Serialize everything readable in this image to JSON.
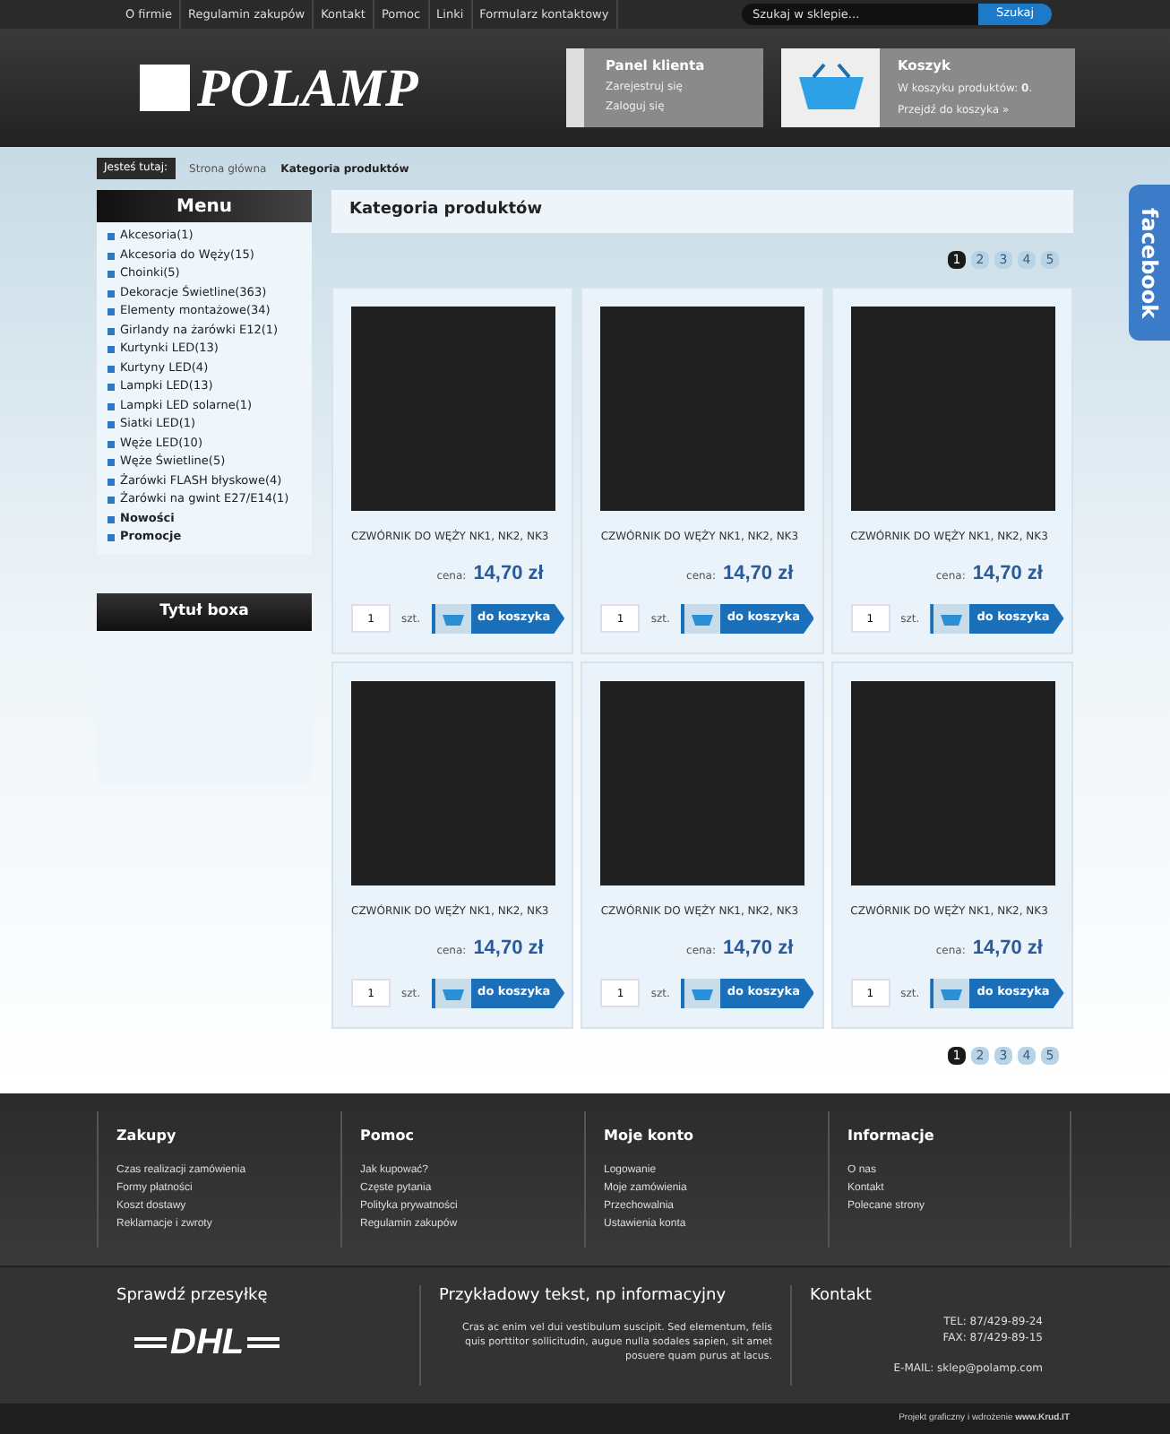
{
  "top_nav": {
    "links": [
      "O firmie",
      "Regulamin zakupów",
      "Kontakt",
      "Pomoc",
      "Linki",
      "Formularz kontaktowy"
    ],
    "search": {
      "placeholder": "Szukaj w sklepie..."
    },
    "search_button": "Szukaj"
  },
  "logo": "POLAMP",
  "client_panel": {
    "title": "Panel klienta",
    "links": [
      "Zarejestruj się",
      "Zaloguj się"
    ]
  },
  "cart": {
    "title": "Koszyk",
    "summary": "W koszyku produktów: **0**.",
    "link": "Przejdź do koszyka »"
  },
  "breadcrumb": {
    "label": "Jesteś tutaj:",
    "items": [
      "Strona główna",
      "Kategoria produktów"
    ]
  },
  "menu": {
    "title": "Menu",
    "items": [
      {
        "label": "Akcesoria(1)",
        "bold": false
      },
      {
        "label": "Akcesoria do Węży(15)",
        "bold": false
      },
      {
        "label": "Choinki(5)",
        "bold": false
      },
      {
        "label": "Dekoracje Świetline(363)",
        "bold": false
      },
      {
        "label": "Elementy montażowe(34)",
        "bold": false
      },
      {
        "label": "Girlandy na żarówki E12(1)",
        "bold": false
      },
      {
        "label": "Kurtynki LED(13)",
        "bold": false
      },
      {
        "label": "Kurtyny LED(4)",
        "bold": false
      },
      {
        "label": "Lampki LED(13)",
        "bold": false
      },
      {
        "label": "Lampki LED solarne(1)",
        "bold": false
      },
      {
        "label": "Siatki LED(1)",
        "bold": false
      },
      {
        "label": "Węże LED(10)",
        "bold": false
      },
      {
        "label": "Węże Świetline(5)",
        "bold": false
      },
      {
        "label": "Żarówki FLASH błyskowe(4)",
        "bold": false
      },
      {
        "label": "Żarówki na gwint E27/E14(1)",
        "bold": false
      },
      {
        "label": "Nowości",
        "bold": true
      },
      {
        "label": "Promocje",
        "bold": true
      }
    ]
  },
  "side_box": {
    "title": "Tytuł boxa"
  },
  "content": {
    "title": "Kategoria produktów",
    "pagination_top": [
      {
        "label": "1",
        "selected": true
      },
      {
        "label": "2",
        "selected": false
      },
      {
        "label": "3",
        "selected": false
      },
      {
        "label": "4",
        "selected": false
      },
      {
        "label": "5",
        "selected": false
      }
    ],
    "products": [
      {
        "name": "CZWÓRNIK DO WĘŻY NK1, NK2, NK3",
        "price_label": "cena:",
        "price": "14,70 zł",
        "qty": "1",
        "unit": "szt.",
        "button": "do koszyka"
      },
      {
        "name": "CZWÓRNIK DO WĘŻY NK1, NK2, NK3",
        "price_label": "cena:",
        "price": "14,70 zł",
        "qty": "1",
        "unit": "szt.",
        "button": "do koszyka"
      },
      {
        "name": "CZWÓRNIK DO WĘŻY NK1, NK2, NK3",
        "price_label": "cena:",
        "price": "14,70 zł",
        "qty": "1",
        "unit": "szt.",
        "button": "do koszyka"
      },
      {
        "name": "CZWÓRNIK DO WĘŻY NK1, NK2, NK3",
        "price_label": "cena:",
        "price": "14,70 zł",
        "qty": "1",
        "unit": "szt.",
        "button": "do koszyka"
      },
      {
        "name": "CZWÓRNIK DO WĘŻY NK1, NK2, NK3",
        "price_label": "cena:",
        "price": "14,70 zł",
        "qty": "1",
        "unit": "szt.",
        "button": "do koszyka"
      },
      {
        "name": "CZWÓRNIK DO WĘŻY NK1, NK2, NK3",
        "price_label": "cena:",
        "price": "14,70 zł",
        "qty": "1",
        "unit": "szt.",
        "button": "do koszyka"
      }
    ],
    "pagination_bottom": [
      {
        "label": "1",
        "selected": true
      },
      {
        "label": "2",
        "selected": false
      },
      {
        "label": "3",
        "selected": false
      },
      {
        "label": "4",
        "selected": false
      },
      {
        "label": "5",
        "selected": false
      }
    ]
  },
  "facebook_tab": "facebook",
  "footer_columns": [
    {
      "title": "Zakupy",
      "links": [
        "Czas realizacji zamówienia",
        "Formy płatności",
        "Koszt dostawy",
        "Reklamacje i zwroty"
      ]
    },
    {
      "title": "Pomoc",
      "links": [
        "Jak kupować?",
        "Częste pytania",
        "Polityka prywatności",
        "Regulamin zakupów"
      ]
    },
    {
      "title": "Moje konto",
      "links": [
        "Logowanie",
        "Moje zamówienia",
        "Przechowalnia",
        "Ustawienia konta"
      ]
    },
    {
      "title": "Informacje",
      "links": [
        "O nas",
        "Kontakt",
        "Polecane strony"
      ]
    }
  ],
  "footer_info": {
    "tracking_title": "Sprawdź przesyłkę",
    "courier_logo": "DHL",
    "text_title": "Przykładowy tekst, np informacyjny",
    "text": "Cras ac enim vel dui vestibulum suscipit. Sed elementum, felis quis porttitor sollicitudin, augue nulla sodales sapien, sit amet posuere quam purus at lacus.",
    "contact_title": "Kontakt",
    "phone": "TEL: 87/429-89-24",
    "fax": "FAX: 87/429-89-15",
    "email": "E-MAIL: sklep@polamp.com"
  },
  "credit": "Projekt graficzny i wdrożenie **www.Krud.IT**"
}
